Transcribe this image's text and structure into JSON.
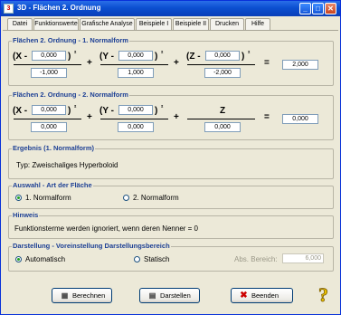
{
  "window": {
    "title": "3D - Flächen 2. Ordnung",
    "icon_label": "3",
    "minimize": "_",
    "maximize": "□",
    "close": "✕"
  },
  "menu": [
    "Datei",
    "Funktionswerte",
    "Grafische Analyse",
    "Beispiele I",
    "Beispiele II",
    "Drucken",
    "Hilfe"
  ],
  "form1": {
    "title": "Flächen 2. Ordnung - 1. Normalform",
    "x_label": "(X -",
    "y_label": "(Y -",
    "z_label": "(Z -",
    "close": ")",
    "square": "²",
    "x0": "0,000",
    "y0": "0,000",
    "z0": "0,000",
    "a": "-1,000",
    "b": "1,000",
    "c": "-2,000",
    "plus": "+",
    "equals": "=",
    "result": "2,000"
  },
  "form2": {
    "title": "Flächen 2. Ordnung - 2. Normalform",
    "x_label": "(X -",
    "y_label": "(Y -",
    "z_label": "Z",
    "close": ")",
    "square": "²",
    "x0": "0,000",
    "y0": "0,000",
    "a": "0,000",
    "b": "0,000",
    "c": "0,000",
    "plus": "+",
    "equals": "=",
    "result": "0,000"
  },
  "ergebnis": {
    "title": "Ergebnis (1. Normalform)",
    "text": "Typ: Zweischaliges Hyperboloid"
  },
  "auswahl": {
    "title": "Auswahl - Art der Fläche",
    "option1": "1. Normalform",
    "option2": "2. Normalform",
    "selected": "1. Normalform"
  },
  "hinweis": {
    "title": "Hinweis",
    "text": "Funktionsterme werden ignoriert, wenn deren Nenner = 0"
  },
  "darstellung": {
    "title": "Darstellung - Voreinstellung Darstellungsbereich",
    "option1": "Automatisch",
    "option2": "Statisch",
    "selected": "Automatisch",
    "range_label": "Abs. Bereich:",
    "range_value": "6,000"
  },
  "buttons": {
    "calculate": "Berechnen",
    "display": "Darstellen",
    "quit": "Beenden"
  },
  "icons": {
    "calculate": "calculator-icon",
    "display": "chart-icon",
    "quit": "close-x-icon",
    "help": "help-question-icon"
  },
  "colors": {
    "titlebar": "#0b4fd0",
    "group_title": "#1c3f94",
    "background": "#ece9d8",
    "quit_icon": "#cc0000",
    "help_icon": "#e8c000"
  }
}
